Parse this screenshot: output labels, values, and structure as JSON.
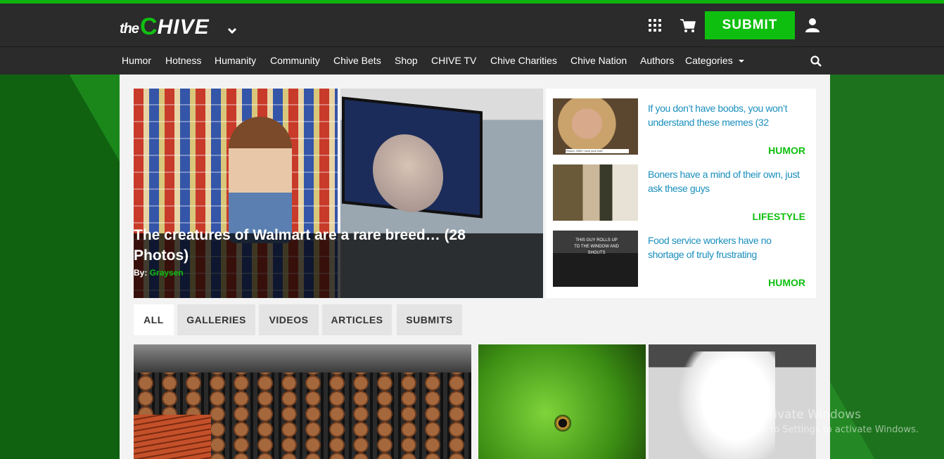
{
  "brand": {
    "logo_the": "the",
    "logo_c": "C",
    "logo_hive": "HIVE",
    "accent": "#0fbf0f",
    "header_bg": "#2b2b2b"
  },
  "header": {
    "submit_label": "SUBMIT",
    "icons": [
      "chevron-down-icon",
      "apps-grid-icon",
      "cart-icon",
      "user-icon"
    ]
  },
  "nav": {
    "items": [
      "Humor",
      "Hotness",
      "Humanity",
      "Community",
      "Chive Bets",
      "Shop",
      "CHIVE TV",
      "Chive Charities",
      "Chive Nation",
      "Authors"
    ],
    "categories_label": "Categories"
  },
  "hero": {
    "title": "The creatures of Walmart are a rare breed… (28 Photos)",
    "by_label": "By:",
    "author": "Graysen"
  },
  "sidebar": {
    "items": [
      {
        "title": "If you don’t have boobs, you won’t understand these memes (32",
        "category": "HUMOR",
        "thumb_caption": "Person: OMG I love your hair!"
      },
      {
        "title": "Boners have a mind of their own, just ask these guys",
        "category": "LIFESTYLE"
      },
      {
        "title": "Food service workers have no shortage of truly frustrating",
        "category": "HUMOR",
        "thumb_caption": "THIS GUY ROLLS UP TO THE WINDOW AND SHOUTS"
      }
    ]
  },
  "tabs": [
    "ALL",
    "GALLERIES",
    "VIDEOS",
    "ARTICLES",
    "SUBMITS"
  ],
  "watermark": {
    "line1": "Activate Windows",
    "line2": "Go to Settings to activate Windows."
  }
}
